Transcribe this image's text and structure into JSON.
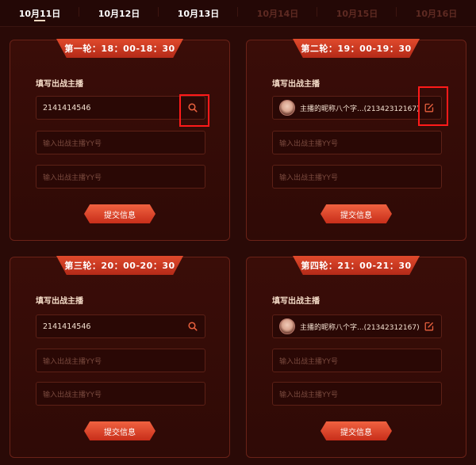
{
  "tabs": [
    {
      "label": "10月11日",
      "state": "active"
    },
    {
      "label": "10月12日",
      "state": "normal"
    },
    {
      "label": "10月13日",
      "state": "normal"
    },
    {
      "label": "10月14日",
      "state": "disabled"
    },
    {
      "label": "10月15日",
      "state": "disabled"
    },
    {
      "label": "10月16日",
      "state": "disabled"
    }
  ],
  "cards": [
    {
      "title": "第一轮：18：00-18：30",
      "section_label": "填写出战主播",
      "anchor_value": "2141414546",
      "anchor_icon": "search-icon",
      "yy_placeholder_1": "输入出战主播YY号",
      "yy_placeholder_2": "输入出战主播YY号",
      "submit_label": "提交信息"
    },
    {
      "title": "第二轮：19：00-19：30",
      "section_label": "填写出战主播",
      "anchor_display": "主播的昵称八个字...(21342312167)",
      "anchor_icon": "edit-icon",
      "yy_placeholder_1": "输入出战主播YY号",
      "yy_placeholder_2": "输入出战主播YY号",
      "submit_label": "提交信息"
    },
    {
      "title": "第三轮：20：00-20：30",
      "section_label": "填写出战主播",
      "anchor_value": "2141414546",
      "anchor_icon": "search-icon",
      "yy_placeholder_1": "输入出战主播YY号",
      "yy_placeholder_2": "输入出战主播YY号",
      "submit_label": "提交信息"
    },
    {
      "title": "第四轮：21：00-21：30",
      "section_label": "填写出战主播",
      "anchor_display": "主播的昵称八个字...(21342312167)",
      "anchor_icon": "edit-icon",
      "yy_placeholder_1": "输入出战主播YY号",
      "yy_placeholder_2": "输入出战主播YY号",
      "submit_label": "提交信息"
    }
  ],
  "colors": {
    "accent": "#e04a2c",
    "highlight": "#ff1a1a",
    "background": "#2a0a07"
  }
}
